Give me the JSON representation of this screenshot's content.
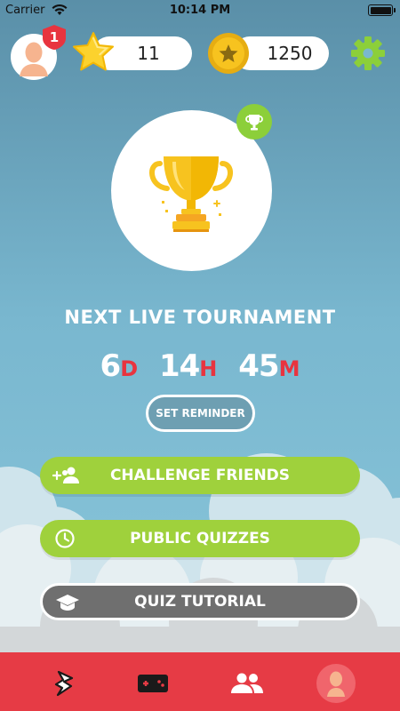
{
  "status_bar": {
    "carrier": "Carrier",
    "time": "10:14 PM"
  },
  "header": {
    "notification_count": "1",
    "stars": "11",
    "coins": "1250"
  },
  "tournament": {
    "title": "NEXT LIVE TOURNAMENT",
    "days": "6",
    "days_unit": "D",
    "hours": "14",
    "hours_unit": "H",
    "minutes": "45",
    "minutes_unit": "M",
    "reminder_label": "SET REMINDER"
  },
  "menu": {
    "challenge_label": "CHALLENGE FRIENDS",
    "public_label": "PUBLIC QUIZZES",
    "tutorial_label": "QUIZ TUTORIAL"
  },
  "colors": {
    "accent_red": "#e63b45",
    "accent_green": "#9fd13c",
    "coin_gold": "#f7c31f",
    "tutorial_gray": "#6f6f6f"
  },
  "icons": {
    "nav": [
      "bolt-icon",
      "gamepad-icon",
      "friends-icon",
      "profile-icon"
    ]
  }
}
